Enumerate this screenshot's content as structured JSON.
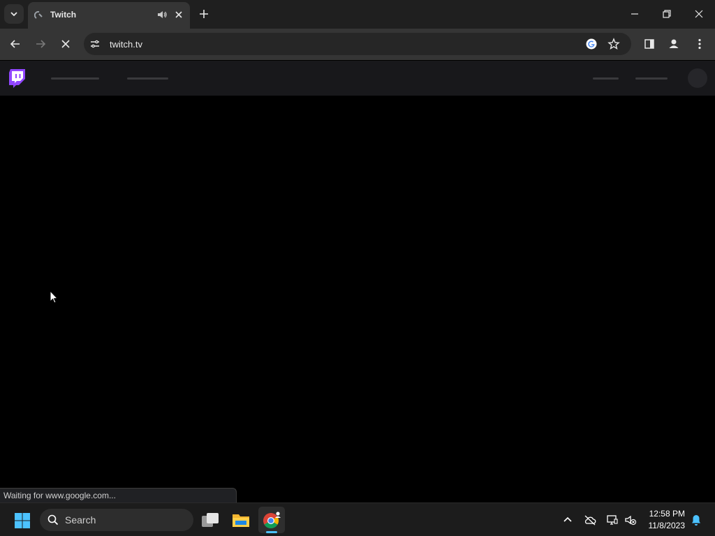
{
  "browser": {
    "tab": {
      "title": "Twitch"
    },
    "address_bar": {
      "url": "twitch.tv"
    }
  },
  "status_bar": {
    "text": "Waiting for www.google.com..."
  },
  "taskbar": {
    "search": {
      "placeholder": "Search"
    },
    "clock": {
      "time": "12:58 PM",
      "date": "11/8/2023"
    }
  },
  "colors": {
    "twitch_purple": "#9146ff",
    "taskbar_indicator": "#4cc2ff"
  }
}
